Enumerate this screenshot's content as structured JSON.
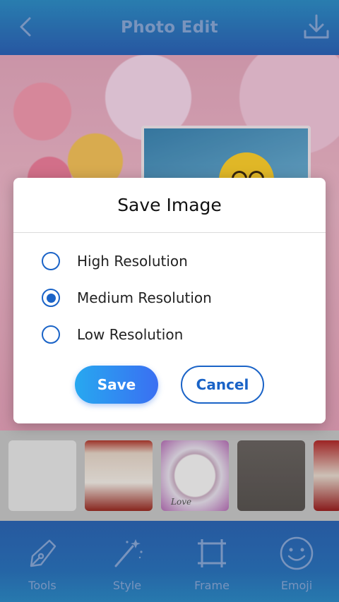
{
  "header": {
    "title": "Photo Edit",
    "back_icon": "chevron-left-icon",
    "download_icon": "download-icon"
  },
  "dialog": {
    "title": "Save Image",
    "options": [
      {
        "label": "High Resolution",
        "selected": false
      },
      {
        "label": "Medium Resolution",
        "selected": true
      },
      {
        "label": "Low Resolution",
        "selected": false
      }
    ],
    "save_label": "Save",
    "cancel_label": "Cancel"
  },
  "frame_strip": {
    "thumbnails": [
      "frame-blank",
      "frame-red-heart",
      "frame-oval-love",
      "frame-gray",
      "frame-red-partial"
    ],
    "thumb_text": "Love"
  },
  "bottom_nav": {
    "items": [
      {
        "label": "Tools",
        "icon": "pen-nib-icon"
      },
      {
        "label": "Style",
        "icon": "magic-wand-icon"
      },
      {
        "label": "Frame",
        "icon": "crop-frame-icon"
      },
      {
        "label": "Emoji",
        "icon": "smiley-icon"
      }
    ]
  },
  "colors": {
    "header_bg": "#2d63b8",
    "accent": "#1a63c7",
    "nav_label": "#8aa9d8"
  }
}
